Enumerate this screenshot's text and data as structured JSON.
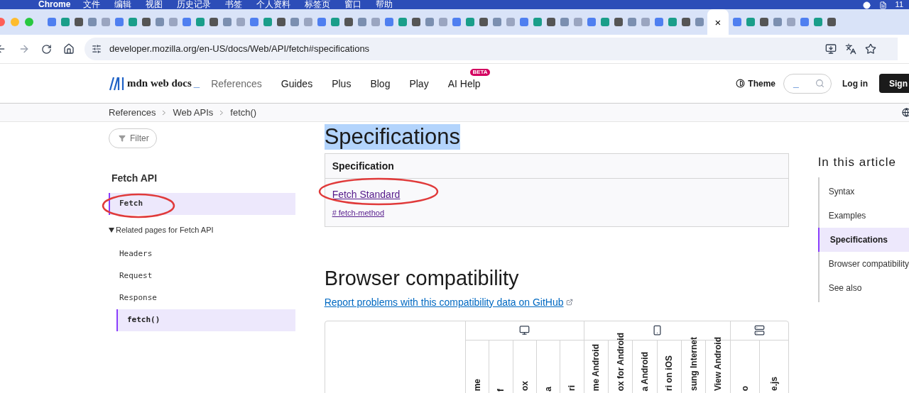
{
  "menu_bar": {
    "app": "Chrome",
    "items": [
      "文件",
      "编辑",
      "视图",
      "历史记录",
      "书签",
      "个人资料",
      "标签页",
      "窗口",
      "帮助"
    ],
    "badge": "11"
  },
  "tabs": [
    {
      "selected": false
    },
    {
      "selected": false
    },
    {
      "selected": false
    },
    {
      "selected": false
    },
    {
      "selected": false
    },
    {
      "selected": false
    },
    {
      "selected": false
    },
    {
      "selected": false
    },
    {
      "selected": false
    },
    {
      "selected": false
    },
    {
      "selected": false
    },
    {
      "selected": false
    },
    {
      "selected": false
    },
    {
      "selected": false
    },
    {
      "selected": false
    },
    {
      "selected": false
    },
    {
      "selected": false
    },
    {
      "selected": false
    },
    {
      "selected": false
    },
    {
      "selected": false
    },
    {
      "selected": false
    },
    {
      "selected": false
    },
    {
      "selected": false
    },
    {
      "selected": false
    },
    {
      "selected": false
    },
    {
      "selected": false
    },
    {
      "selected": false
    },
    {
      "selected": false
    },
    {
      "selected": false
    },
    {
      "selected": false
    },
    {
      "selected": false
    },
    {
      "selected": false
    },
    {
      "selected": false
    },
    {
      "selected": false
    },
    {
      "selected": false
    },
    {
      "selected": false
    },
    {
      "selected": false
    },
    {
      "selected": false
    },
    {
      "selected": false
    },
    {
      "selected": false
    },
    {
      "selected": false
    },
    {
      "selected": false
    },
    {
      "selected": false
    },
    {
      "selected": false
    },
    {
      "selected": false
    },
    {
      "selected": false
    },
    {
      "selected": false
    },
    {
      "selected": false
    },
    {
      "selected": false
    },
    {
      "selected": true
    },
    {
      "selected": false
    },
    {
      "selected": false
    },
    {
      "selected": false
    },
    {
      "selected": false
    },
    {
      "selected": false
    },
    {
      "selected": false
    },
    {
      "selected": false
    },
    {
      "selected": false
    }
  ],
  "tab_close": "×",
  "address_bar": {
    "url": "developer.mozilla.org/en-US/docs/Web/API/fetch#specifications"
  },
  "header": {
    "logo": "mdn web docs",
    "logo_cursor": "_",
    "nav": [
      {
        "label": "References",
        "selected": true
      },
      {
        "label": "Guides",
        "selected": false
      },
      {
        "label": "Plus",
        "selected": false
      },
      {
        "label": "Blog",
        "selected": false
      },
      {
        "label": "Play",
        "selected": false
      },
      {
        "label": "AI Help",
        "selected": false,
        "badge": "BETA"
      }
    ],
    "theme": "Theme",
    "search_value": "_",
    "login": "Log in",
    "signup": "Sign"
  },
  "breadcrumbs": [
    "References",
    "Web APIs",
    "fetch()"
  ],
  "sidebar": {
    "filter": "Filter",
    "title": "Fetch API",
    "items": [
      {
        "label": "Fetch",
        "selected": true,
        "circled": true
      },
      {
        "label": "Related pages for Fetch API",
        "expanded": true,
        "children": [
          {
            "label": "Headers",
            "selected": false
          },
          {
            "label": "Request",
            "selected": false
          },
          {
            "label": "Response",
            "selected": false
          },
          {
            "label": "fetch()",
            "selected": true
          }
        ]
      }
    ]
  },
  "main": {
    "spec_heading": {
      "text": "Specifications",
      "highlighted": true
    },
    "spec_table": {
      "column": "Specification",
      "rows": [
        {
          "link": "Fetch Standard",
          "anchor": "# fetch-method",
          "circled": true
        }
      ]
    },
    "compat_heading": "Browser compatibility",
    "report_link": "Report problems with this compatibility data on GitHub",
    "compat_table": {
      "groups": [
        {
          "kind": "desktop",
          "columns": [
            "me",
            "f",
            "ox",
            "a",
            "ri"
          ]
        },
        {
          "kind": "mobile",
          "columns": [
            "me Android",
            "ox for Android",
            "a Android",
            "ri on iOS",
            "sung Internet",
            "View Android"
          ]
        },
        {
          "kind": "server",
          "columns": [
            "o",
            "e.js"
          ]
        }
      ]
    }
  },
  "toc": {
    "title": "In this article",
    "items": [
      {
        "label": "Syntax",
        "selected": false
      },
      {
        "label": "Examples",
        "selected": false
      },
      {
        "label": "Specifications",
        "selected": true
      },
      {
        "label": "Browser compatibility",
        "selected": false
      },
      {
        "label": "See also",
        "selected": false
      }
    ]
  }
}
